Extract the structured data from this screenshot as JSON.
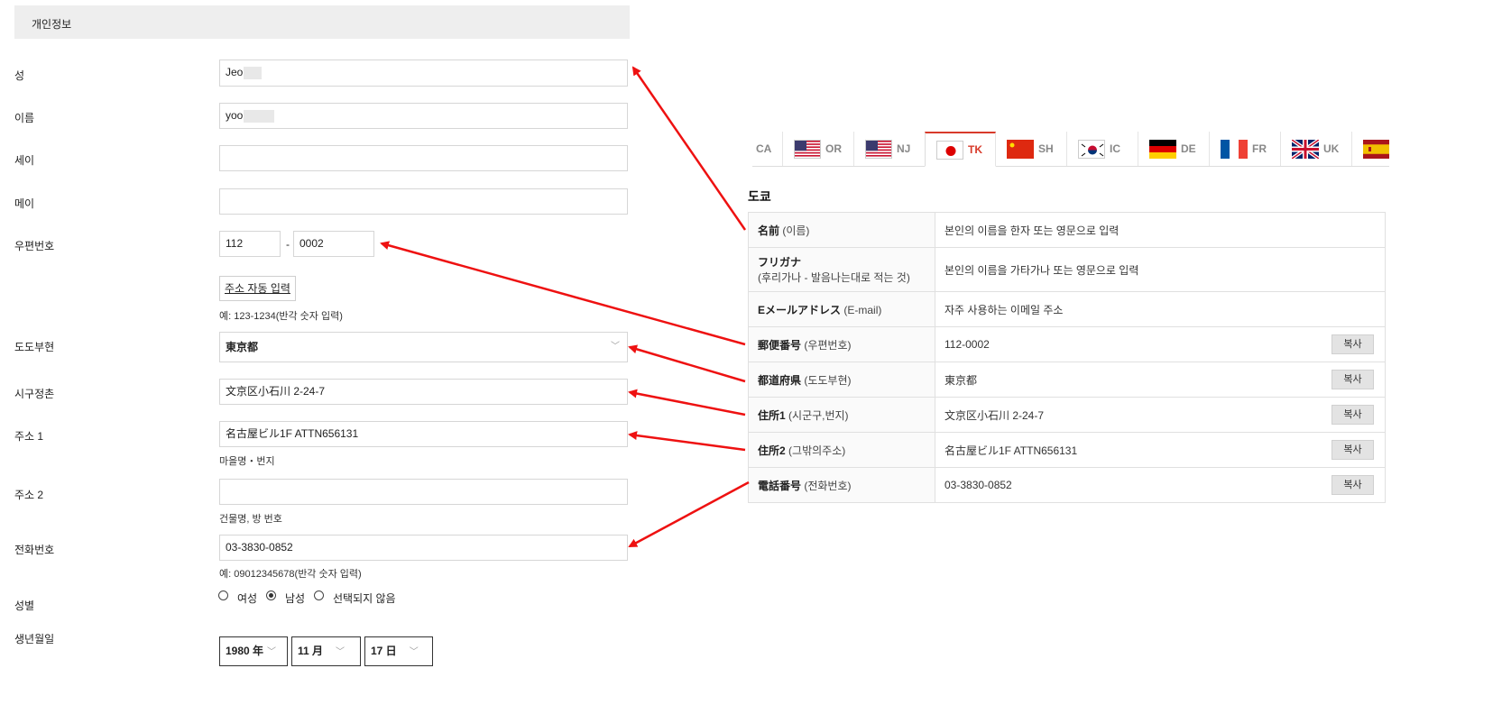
{
  "form": {
    "section_title": "개인정보",
    "labels": {
      "last_name": "성",
      "first_name": "이름",
      "sei": "세이",
      "mei": "메이",
      "postal": "우편번호",
      "prefecture": "도도부현",
      "city": "시구정촌",
      "address1": "주소 1",
      "address2": "주소 2",
      "phone": "전화번호",
      "gender": "성별",
      "birth": "생년월일"
    },
    "values": {
      "last_name": "Jeo",
      "first_name": "yoo",
      "sei": "",
      "mei": "",
      "postal1": "112",
      "postal_sep": "-",
      "postal2": "0002",
      "prefecture": "東京都",
      "city": "文京区小石川 2-24-7",
      "address1": "名古屋ビル1F ATTN656131",
      "address2": "",
      "phone": "03-3830-0852"
    },
    "address_button": "주소 자동 입력",
    "hints": {
      "postal": "예: 123-1234(반각 숫자 입력)",
      "address1": "마을명・번지",
      "address2": "건물명, 방 번호",
      "phone": "예: 09012345678(반각 숫자 입력)"
    },
    "gender_options": [
      "여성",
      "남성",
      "선택되지 않음"
    ],
    "gender_selected": "남성",
    "birth": {
      "year": "1980 年",
      "month": "11 月",
      "day": "17 日"
    }
  },
  "tabs": [
    {
      "label": "CA",
      "flag": "none"
    },
    {
      "label": "OR",
      "flag": "us-flag"
    },
    {
      "label": "NJ",
      "flag": "us-flag"
    },
    {
      "label": "TK",
      "flag": "japan-flag",
      "active": true
    },
    {
      "label": "SH",
      "flag": "china-flag"
    },
    {
      "label": "IC",
      "flag": "korea-flag"
    },
    {
      "label": "DE",
      "flag": "germany-flag"
    },
    {
      "label": "FR",
      "flag": "france-flag"
    },
    {
      "label": "UK",
      "flag": "uk-flag"
    },
    {
      "label": "",
      "flag": "spain-flag"
    }
  ],
  "info": {
    "title": "도쿄",
    "copy_label": "복사",
    "rows": [
      {
        "key_main": "名前",
        "key_sub": "(이름)",
        "value": "본인의 이름을 한자 또는 영문으로 입력"
      },
      {
        "key_main": "フリガナ",
        "key_sub": "(후리가나 - 발음나는대로 적는 것)",
        "value": "본인의 이름을 가타가나 또는 영문으로 입력"
      },
      {
        "key_main": "Eメールアドレス",
        "key_sub": "(E-mail)",
        "value": "자주 사용하는 이메일 주소"
      },
      {
        "key_main": "郵便番号",
        "key_sub": "(우편번호)",
        "value": "112-0002"
      },
      {
        "key_main": "都道府県",
        "key_sub": "(도도부현)",
        "value": "東京都"
      },
      {
        "key_main": "住所1",
        "key_sub": "(시군구,번지)",
        "value": "文京区小石川 2-24-7"
      },
      {
        "key_main": "住所2",
        "key_sub": "(그밖의주소)",
        "value": "名古屋ビル1F ATTN656131"
      },
      {
        "key_main": "電話番号",
        "key_sub": "(전화번호)",
        "value": "03-3830-0852"
      }
    ]
  },
  "colors": {
    "accent": "#d83a2a",
    "arrow": "#ee1111"
  }
}
